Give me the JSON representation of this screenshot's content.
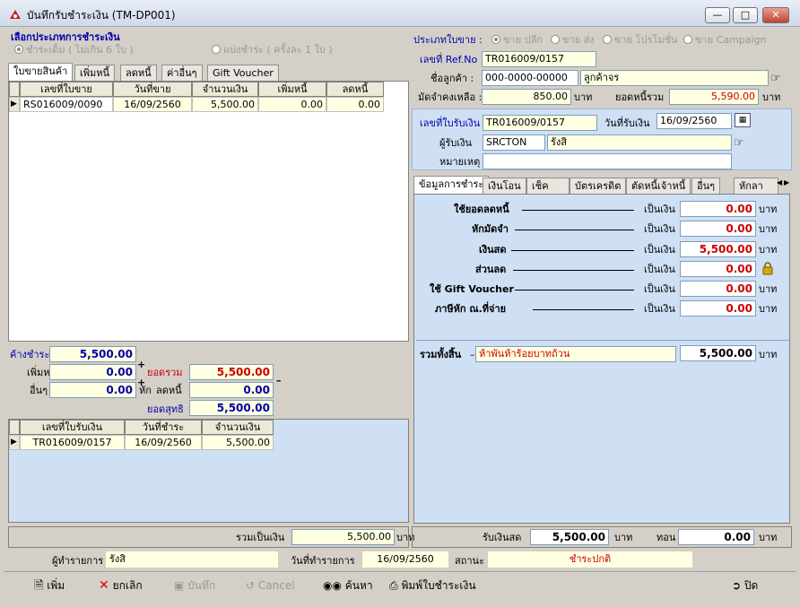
{
  "window": {
    "title": "บันทึกรับชำระเงิน (TM-DP001)"
  },
  "payment_method": {
    "title": "เลือกประเภทการชำระเงิน",
    "options": [
      "ชำระเต็ม ( ไม่เกิน 6 ใบ )",
      "แบ่งชำระ ( ครั้งละ 1 ใบ )"
    ]
  },
  "sale_type": {
    "label": "ประเภทใบขาย :",
    "options": [
      "ขาย ปลีก",
      "ขาย ส่ง",
      "ขาย โปรโมชั่น",
      "ขาย Campaign"
    ]
  },
  "left_tabs": [
    "ใบขายสินค้า",
    "เพิ่มหนี้",
    "ลดหนี้",
    "ค่าอื่นๆ",
    "Gift Voucher"
  ],
  "sales_grid": {
    "headers": [
      "เลขที่ใบขาย",
      "วันที่ขาย",
      "จำนวนเงิน",
      "เพิ่มหนี้",
      "ลดหนี้"
    ],
    "rows": [
      [
        "RS016009/0090",
        "16/09/2560",
        "5,500.00",
        "0.00",
        "0.00"
      ]
    ]
  },
  "summary": {
    "outstanding_label": "ค้างชำระ",
    "outstanding": "5,500.00",
    "add_debt_label": "เพิ่มหนี้",
    "add_debt": "0.00",
    "other_label": "อื่นๆ",
    "other": "0.00",
    "total_label": "ยอดรวม",
    "total": "5,500.00",
    "less_label": "หัก",
    "reduce_label": "ลดหนี้",
    "reduce": "0.00",
    "net_label": "ยอดสุทธิ",
    "net": "5,500.00"
  },
  "receipt_grid": {
    "headers": [
      "เลขที่ใบรับเงิน",
      "วันที่ชำระ",
      "จำนวนเงิน"
    ],
    "rows": [
      [
        "TR016009/0157",
        "16/09/2560",
        "5,500.00"
      ]
    ]
  },
  "left_footer": {
    "label": "รวมเป็นเงิน",
    "value": "5,500.00",
    "unit": "บาท"
  },
  "ref": {
    "ref_label": "เลขที่ Ref.No :",
    "ref_no": "TR016009/0157",
    "customer_label": "ชื่อลูกค้า :",
    "customer_code": "000-0000-00000",
    "customer_name": "ลูกค้าจร",
    "deposit_label": "มัดจำคงเหลือ :",
    "deposit": "850.00",
    "debt_label": "ยอดหนี้รวม",
    "debt": "5,590.00",
    "unit": "บาท"
  },
  "receipt": {
    "no_label": "เลขที่ใบรับเงิน",
    "no": "TR016009/0157",
    "date_label": "วันที่รับเงิน",
    "date": "16/09/2560",
    "receiver_label": "ผู้รับเงิน",
    "receiver_code": "SRCTON",
    "receiver_name": "รังสิ",
    "note_label": "หมายเหตุ",
    "note": ""
  },
  "right_tabs": [
    "ข้อมูลการชำระ",
    "เงินโอน",
    "เช็ค",
    "บัตรเครดิต",
    "ตัดหนี้เจ้าหนี้",
    "อื่นๆ",
    "หักลา"
  ],
  "payment_rows": [
    {
      "label": "ใช้ยอดลดหนี้",
      "as": "เป็นเงิน",
      "value": "0.00",
      "unit": "บาท"
    },
    {
      "label": "หักมัดจำ",
      "as": "เป็นเงิน",
      "value": "0.00",
      "unit": "บาท"
    },
    {
      "label": "เงินสด",
      "as": "เป็นเงิน",
      "value": "5,500.00",
      "unit": "บาท"
    },
    {
      "label": "ส่วนลด",
      "as": "เป็นเงิน",
      "value": "0.00",
      "unit": ""
    },
    {
      "label": "ใช้ Gift Voucher",
      "as": "เป็นเงิน",
      "value": "0.00",
      "unit": "บาท"
    },
    {
      "label": "ภาษีหัก ณ.ที่จ่าย",
      "as": "เป็นเงิน",
      "value": "0.00",
      "unit": "บาท"
    }
  ],
  "grand_total": {
    "label": "รวมทั้งสิ้น",
    "words": "ห้าพันห้าร้อยบาทถ้วน",
    "value": "5,500.00",
    "unit": "บาท"
  },
  "cash_footer": {
    "received_label": "รับเงินสด",
    "received": "5,500.00",
    "unit": "บาท",
    "change_label": "ทอน",
    "change": "0.00"
  },
  "status_bar": {
    "maker_label": "ผู้ทำรายการ",
    "maker": "รังสิ",
    "date_label": "วันที่ทำรายการ",
    "date": "16/09/2560",
    "status_label": "สถานะ",
    "status": "ชำระปกติ"
  },
  "toolbar": {
    "add": "เพิ่ม",
    "cancel_doc": "ยกเลิก",
    "save": "บันทึก",
    "cancel": "Cancel",
    "search": "ค้นหา",
    "print": "พิมพ์ใบชำระเงิน",
    "close": "ปิด"
  }
}
